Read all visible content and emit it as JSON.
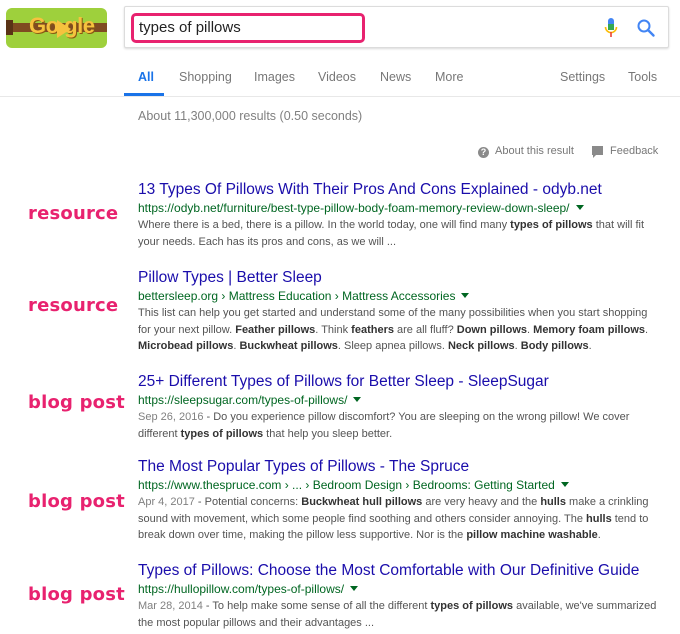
{
  "logo": {
    "text": "Go gle"
  },
  "search": {
    "query": "types of pillows"
  },
  "tabs": [
    {
      "label": "All"
    },
    {
      "label": "Shopping"
    },
    {
      "label": "Images"
    },
    {
      "label": "Videos"
    },
    {
      "label": "News"
    },
    {
      "label": "More"
    },
    {
      "label": "Settings"
    },
    {
      "label": "Tools"
    }
  ],
  "stats": "About 11,300,000 results (0.50 seconds)",
  "about_result": "About this result",
  "feedback": "Feedback",
  "colors": {
    "accent": "#1a73e8",
    "tag": "#e8226f",
    "link": "#1a0dab",
    "url": "#006621"
  },
  "results": [
    {
      "tag": "resource",
      "title": "13 Types Of Pillows With Their Pros And Cons Explained - odyb.net",
      "url": "https://odyb.net/furniture/best-type-pillow-body-foam-memory-review-down-sleep/",
      "date": "",
      "snippet_html": "Where there is a bed, there is a pillow. In the world today, one will find many <b>types of pillows</b> that will fit your needs. Each has its pros and cons, as we will ..."
    },
    {
      "tag": "resource",
      "title": "Pillow Types | Better Sleep",
      "url": "bettersleep.org › Mattress Education › Mattress Accessories",
      "date": "",
      "snippet_html": "This list can help you get started and understand some of the many possibilities when you start shopping for your next pillow. <b>Feather pillows</b>. Think <b>feathers</b> are all fluff? <b>Down pillows</b>. <b>Memory foam pillows</b>. <b>Microbead pillows</b>. <b>Buckwheat pillows</b>. Sleep apnea pillows. <b>Neck pillows</b>. <b>Body pillows</b>."
    },
    {
      "tag": "blog post",
      "title": "25+ Different Types of Pillows for Better Sleep - SleepSugar",
      "url": "https://sleepsugar.com/types-of-pillows/",
      "date": "Sep 26, 2016",
      "snippet_html": "Do you experience pillow discomfort? You are sleeping on the wrong pillow! We cover different <b>types of pillows</b> that help you sleep better."
    },
    {
      "tag": "blog post",
      "title": "The Most Popular Types of Pillows - The Spruce",
      "url": "https://www.thespruce.com › ... › Bedroom Design › Bedrooms: Getting Started",
      "date": "Apr 4, 2017",
      "snippet_html": "Potential concerns: <b>Buckwheat hull pillows</b> are very heavy and the <b>hulls</b> make a crinkling sound with movement, which some people find soothing and others consider annoying. The <b>hulls</b> tend to break down over time, making the pillow less supportive. Nor is the <b>pillow machine washable</b>."
    },
    {
      "tag": "blog post",
      "title": "Types of Pillows: Choose the Most Comfortable with Our Definitive Guide",
      "url": "https://hullopillow.com/types-of-pillows/",
      "date": "Mar 28, 2014",
      "snippet_html": "To help make some sense of all the different <b>types of pillows</b> available, we've summarized the most popular pillows and their advantages ..."
    }
  ]
}
